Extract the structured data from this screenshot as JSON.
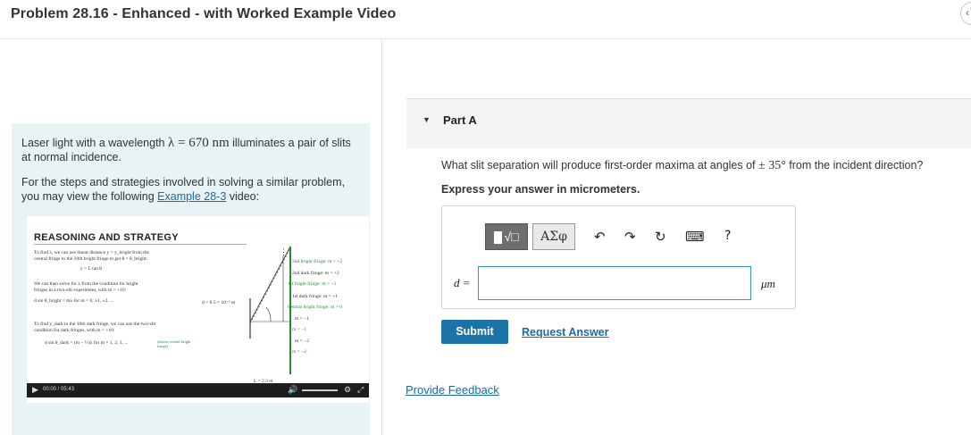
{
  "header": {
    "title": "Problem 28.16 - Enhanced - with Worked Example Video",
    "nav_icon": "chevron-left-icon",
    "nav_glyph": "‹"
  },
  "intro": {
    "p1_pre": "Laser light with a wavelength ",
    "lambda_expr": "λ = 670 nm",
    "p1_post": " illuminates a pair of slits at normal incidence.",
    "p2_pre": "For the steps and strategies involved in solving a similar problem, you may view the following ",
    "link": "Example 28-3",
    "p2_post": " video:"
  },
  "video": {
    "heading": "REASONING AND STRATEGY",
    "lines": [
      "To find λ, we can use linear distance y = y_bright from the",
      "central fringe to the 10th bright fringe to get θ = θ_bright:",
      "y = L tan θ",
      "We can then solve for λ from the condition for bright",
      "fringes in a two-slit experiment, with m = +10:",
      "d sin θ_bright = mλ  for  m = 0, ±1, ±2, ...",
      "To find y_dark to the 10th dark fringe, we can use the two-slit",
      "condition for dark fringes, with m = +10:",
      "d sin θ_dark = (m − ½)λ  for  m = 1, 2, 3, ..."
    ],
    "diagram_labels": [
      "2nd bright fringe: m = +2",
      "2nd dark fringe: m = +2",
      "1st bright fringe: m = +1",
      "1st dark fringe: m = +1",
      "Central bright fringe: m = 0",
      "m = −1",
      "m = −1",
      "m = −2",
      "m = −2"
    ],
    "d_label": "d = 8.5 × 10⁻⁵ m",
    "L_label": "L = 2.3 m",
    "above_note": "(above central bright fringe)",
    "controls": {
      "time": "00:00 / 05:43",
      "play_glyph": "▶",
      "fullscreen_glyph": "⤢",
      "settings_glyph": "⚙",
      "volume_glyph": "🔊"
    }
  },
  "part": {
    "label": "Part A",
    "caret": "▼",
    "question_pre": "What slit separation will produce first-order maxima at angles of ",
    "angle_expr": "± 35°",
    "question_post": " from the incident direction?",
    "instruction": "Express your answer in micrometers."
  },
  "answer": {
    "label": "d =",
    "value": "",
    "unit": "μm",
    "toolbar": {
      "template_label": "√□",
      "greek_label": "ΑΣφ",
      "undo": "↶",
      "redo": "↷",
      "reset": "↻",
      "keyboard": "⌨",
      "help": "?"
    }
  },
  "actions": {
    "submit": "Submit",
    "request_answer": "Request Answer",
    "provide_feedback": "Provide Feedback"
  }
}
